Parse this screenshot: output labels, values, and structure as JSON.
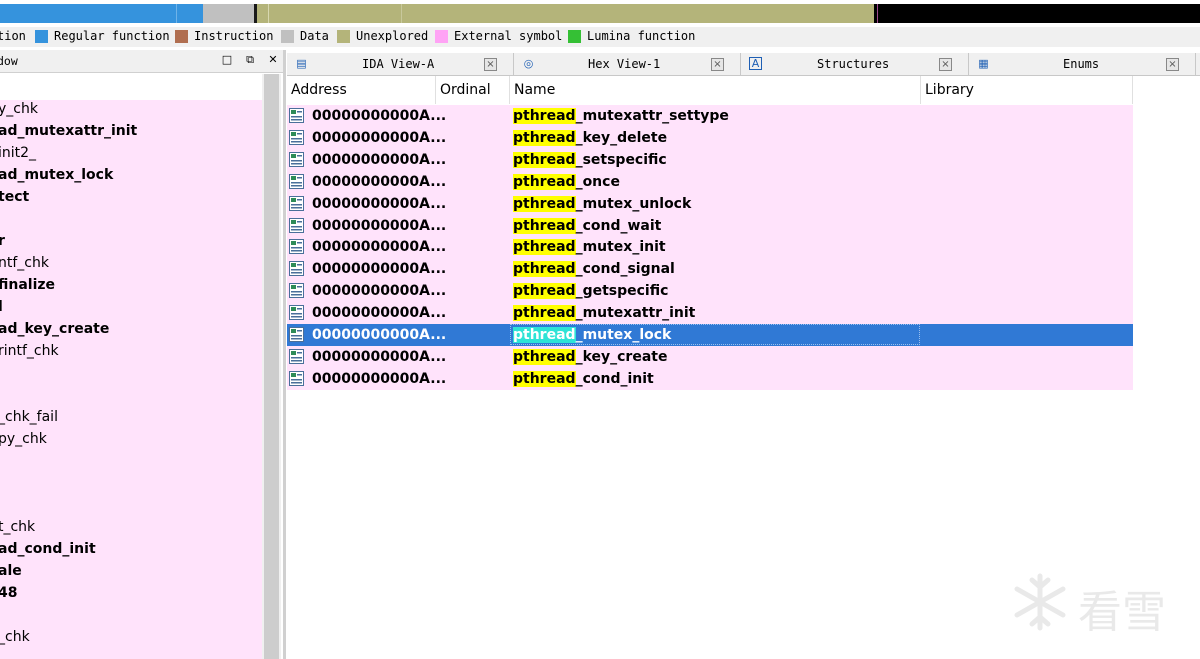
{
  "nav_band": {
    "colors": {
      "regular": "#3593dd",
      "data": "#c0c0c0",
      "unexplored": "#b4b47a",
      "dark": "#000000",
      "cursor": "#1a1a1a"
    }
  },
  "legend": {
    "items": [
      {
        "label": "tion",
        "color": ""
      },
      {
        "label": "Regular function",
        "color": "#3593dd"
      },
      {
        "label": "Instruction",
        "color": "#b06e50"
      },
      {
        "label": "Data",
        "color": "#c0c0c0"
      },
      {
        "label": "Unexplored",
        "color": "#b4b47a"
      },
      {
        "label": "External symbol",
        "color": "#ffa3f5"
      },
      {
        "label": "Lumina function",
        "color": "#35c035"
      }
    ]
  },
  "functions_window": {
    "title": "dow",
    "buttons": {
      "minimize": "□",
      "float": "⧉",
      "close": "✕"
    },
    "items": [
      {
        "label": "y_chk",
        "bold": false
      },
      {
        "label": "ad_mutexattr_init",
        "bold": true
      },
      {
        "label": "init2_",
        "bold": false
      },
      {
        "label": "ad_mutex_lock",
        "bold": true
      },
      {
        "label": "tect",
        "bold": true
      },
      {
        "label": "",
        "bold": false
      },
      {
        "label": "r",
        "bold": true
      },
      {
        "label": "ntf_chk",
        "bold": false
      },
      {
        "label": "finalize",
        "bold": true
      },
      {
        "label": "l",
        "bold": true
      },
      {
        "label": "ad_key_create",
        "bold": true
      },
      {
        "label": "rintf_chk",
        "bold": false
      },
      {
        "label": "",
        "bold": false
      },
      {
        "label": "",
        "bold": false
      },
      {
        "label": "_chk_fail",
        "bold": false
      },
      {
        "label": "py_chk",
        "bold": false
      },
      {
        "label": "",
        "bold": false
      },
      {
        "label": "",
        "bold": false
      },
      {
        "label": "",
        "bold": false
      },
      {
        "label": "t_chk",
        "bold": false
      },
      {
        "label": "ad_cond_init",
        "bold": true
      },
      {
        "label": "ale",
        "bold": true
      },
      {
        "label": "48",
        "bold": true
      },
      {
        "label": "",
        "bold": false
      },
      {
        "label": "_chk",
        "bold": false
      }
    ]
  },
  "tabs": [
    {
      "label": "IDA View-A",
      "icon": "ida-view-icon",
      "glyph": "▤"
    },
    {
      "label": "Hex View-1",
      "icon": "hex-view-icon",
      "glyph": "◎"
    },
    {
      "label": "Structures",
      "icon": "structures-icon",
      "glyph": "A"
    },
    {
      "label": "Enums",
      "icon": "enums-icon",
      "glyph": "▦"
    }
  ],
  "imports": {
    "columns": [
      "Address",
      "Ordinal",
      "Name",
      "Library"
    ],
    "highlight_prefix": "pthread",
    "rows": [
      {
        "address": "00000000000A...",
        "ordinal": "",
        "name_suffix": "_mutexattr_settype",
        "library": ""
      },
      {
        "address": "00000000000A...",
        "ordinal": "",
        "name_suffix": "_key_delete",
        "library": ""
      },
      {
        "address": "00000000000A...",
        "ordinal": "",
        "name_suffix": "_setspecific",
        "library": ""
      },
      {
        "address": "00000000000A...",
        "ordinal": "",
        "name_suffix": "_once",
        "library": ""
      },
      {
        "address": "00000000000A...",
        "ordinal": "",
        "name_suffix": "_mutex_unlock",
        "library": ""
      },
      {
        "address": "00000000000A...",
        "ordinal": "",
        "name_suffix": "_cond_wait",
        "library": ""
      },
      {
        "address": "00000000000A...",
        "ordinal": "",
        "name_suffix": "_mutex_init",
        "library": ""
      },
      {
        "address": "00000000000A...",
        "ordinal": "",
        "name_suffix": "_cond_signal",
        "library": ""
      },
      {
        "address": "00000000000A...",
        "ordinal": "",
        "name_suffix": "_getspecific",
        "library": ""
      },
      {
        "address": "00000000000A...",
        "ordinal": "",
        "name_suffix": "_mutexattr_init",
        "library": ""
      },
      {
        "address": "00000000000A...",
        "ordinal": "",
        "name_suffix": "_mutex_lock",
        "library": "",
        "selected": true
      },
      {
        "address": "00000000000A...",
        "ordinal": "",
        "name_suffix": "_key_create",
        "library": ""
      },
      {
        "address": "00000000000A...",
        "ordinal": "",
        "name_suffix": "_cond_init",
        "library": ""
      }
    ]
  },
  "watermark": {
    "text": "看雪"
  }
}
